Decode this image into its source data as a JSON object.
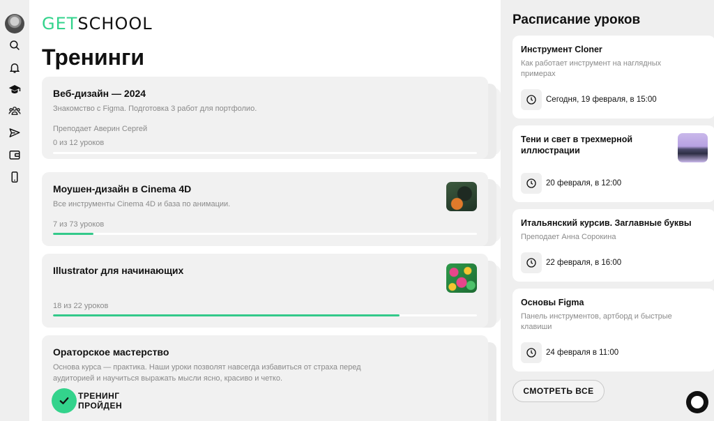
{
  "brand": {
    "logo_get": "GET",
    "logo_school": "SCHOOL"
  },
  "sidebar": {
    "items": [
      {
        "icon": "search-icon"
      },
      {
        "icon": "bell-icon"
      },
      {
        "icon": "graduation-cap-icon"
      },
      {
        "icon": "users-icon"
      },
      {
        "icon": "send-icon"
      },
      {
        "icon": "wallet-icon"
      },
      {
        "icon": "phone-icon"
      }
    ]
  },
  "main": {
    "title": "Тренинги",
    "trainings": [
      {
        "title": "Веб-дизайн — 2024",
        "description": "Знакомство с Figma. Подготовка 3 работ для портфолио.",
        "teacher": "Преподает Аверин Сергей",
        "progress_text": "0 из 12 уроков",
        "progress": 0
      },
      {
        "title": "Моушен-дизайн в Cinema 4D",
        "description": "Все инструменты Cinema 4D и база по анимации.",
        "progress_text": "7 из 73 уроков",
        "progress": 0.0959,
        "thumb": "cinema-4d-thumbnail"
      },
      {
        "title": "Illustrator для начинающих",
        "progress_text": "18 из 22 уроков",
        "progress": 0.818,
        "thumb": "illustrator-thumbnail"
      },
      {
        "title": "Ораторское мастерство",
        "description_line1": "Основа курса — практика. Наши уроки позволят навсегда избавиться от страха перед",
        "description_line2": "аудиторией и научиться выражать мысли ясно, красиво и четко.",
        "badge_line1": "ТРЕНИНГ",
        "badge_line2": "ПРОЙДЕН"
      }
    ]
  },
  "schedule": {
    "title": "Расписание уроков",
    "lessons": [
      {
        "title": "Инструмент Cloner",
        "subtitle_line1": "Как работает инструмент на наглядных",
        "subtitle_line2": "примерах",
        "time": "Сегодня, 19 февраля, в 15:00"
      },
      {
        "title_line1": "Тени и свет в трехмерной",
        "title_line2": "иллюстрации",
        "time": "20 февраля, в 12:00",
        "thumb": "3d-illustration-thumbnail"
      },
      {
        "title": "Итальянский курсив. Заглавные буквы",
        "subtitle_line1": "Преподает Анна Сорокина",
        "time": "22 февраля, в 16:00"
      },
      {
        "title": "Основы Figma",
        "subtitle_line1": "Панель инструментов, артборд и быстрые",
        "subtitle_line2": "клавиши",
        "time": "24 февраля в 11:00"
      }
    ],
    "see_all_label": "СМОТРЕТЬ ВСЕ"
  },
  "colors": {
    "accent": "#33d38c",
    "progress": "#33c98a"
  }
}
